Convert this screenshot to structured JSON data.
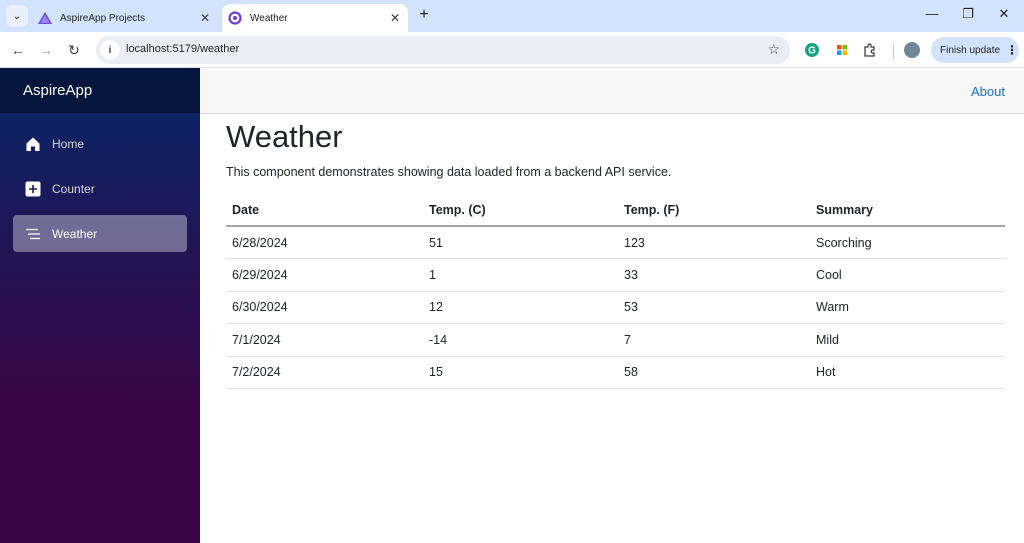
{
  "browser": {
    "tabs": [
      {
        "title": "AspireApp Projects",
        "icon": "aspire-triangle-icon",
        "active": false
      },
      {
        "title": "Weather",
        "icon": "blazor-icon",
        "active": true
      }
    ],
    "new_tab": "+",
    "tab_close": "✕",
    "url": "localhost:5179/weather",
    "finish_update_label": "Finish update",
    "window_controls": {
      "minimize": "—",
      "restore": "❐",
      "close": "✕"
    }
  },
  "sidebar": {
    "brand": "AspireApp",
    "items": [
      {
        "label": "Home",
        "icon": "home-icon",
        "active": false
      },
      {
        "label": "Counter",
        "icon": "plus-square-icon",
        "active": false
      },
      {
        "label": "Weather",
        "icon": "list-icon",
        "active": true
      }
    ]
  },
  "top_row": {
    "about_label": "About"
  },
  "main": {
    "title": "Weather",
    "description": "This component demonstrates showing data loaded from a backend API service.",
    "table": {
      "headers": [
        "Date",
        "Temp. (C)",
        "Temp. (F)",
        "Summary"
      ],
      "rows": [
        [
          "6/28/2024",
          "51",
          "123",
          "Scorching"
        ],
        [
          "6/29/2024",
          "1",
          "33",
          "Cool"
        ],
        [
          "6/30/2024",
          "12",
          "53",
          "Warm"
        ],
        [
          "7/1/2024",
          "-14",
          "7",
          "Mild"
        ],
        [
          "7/2/2024",
          "15",
          "58",
          "Hot"
        ]
      ]
    }
  },
  "colors": {
    "link": "#1b6ec2",
    "sidebar_top": "#052767",
    "sidebar_bottom": "#3a0647"
  }
}
